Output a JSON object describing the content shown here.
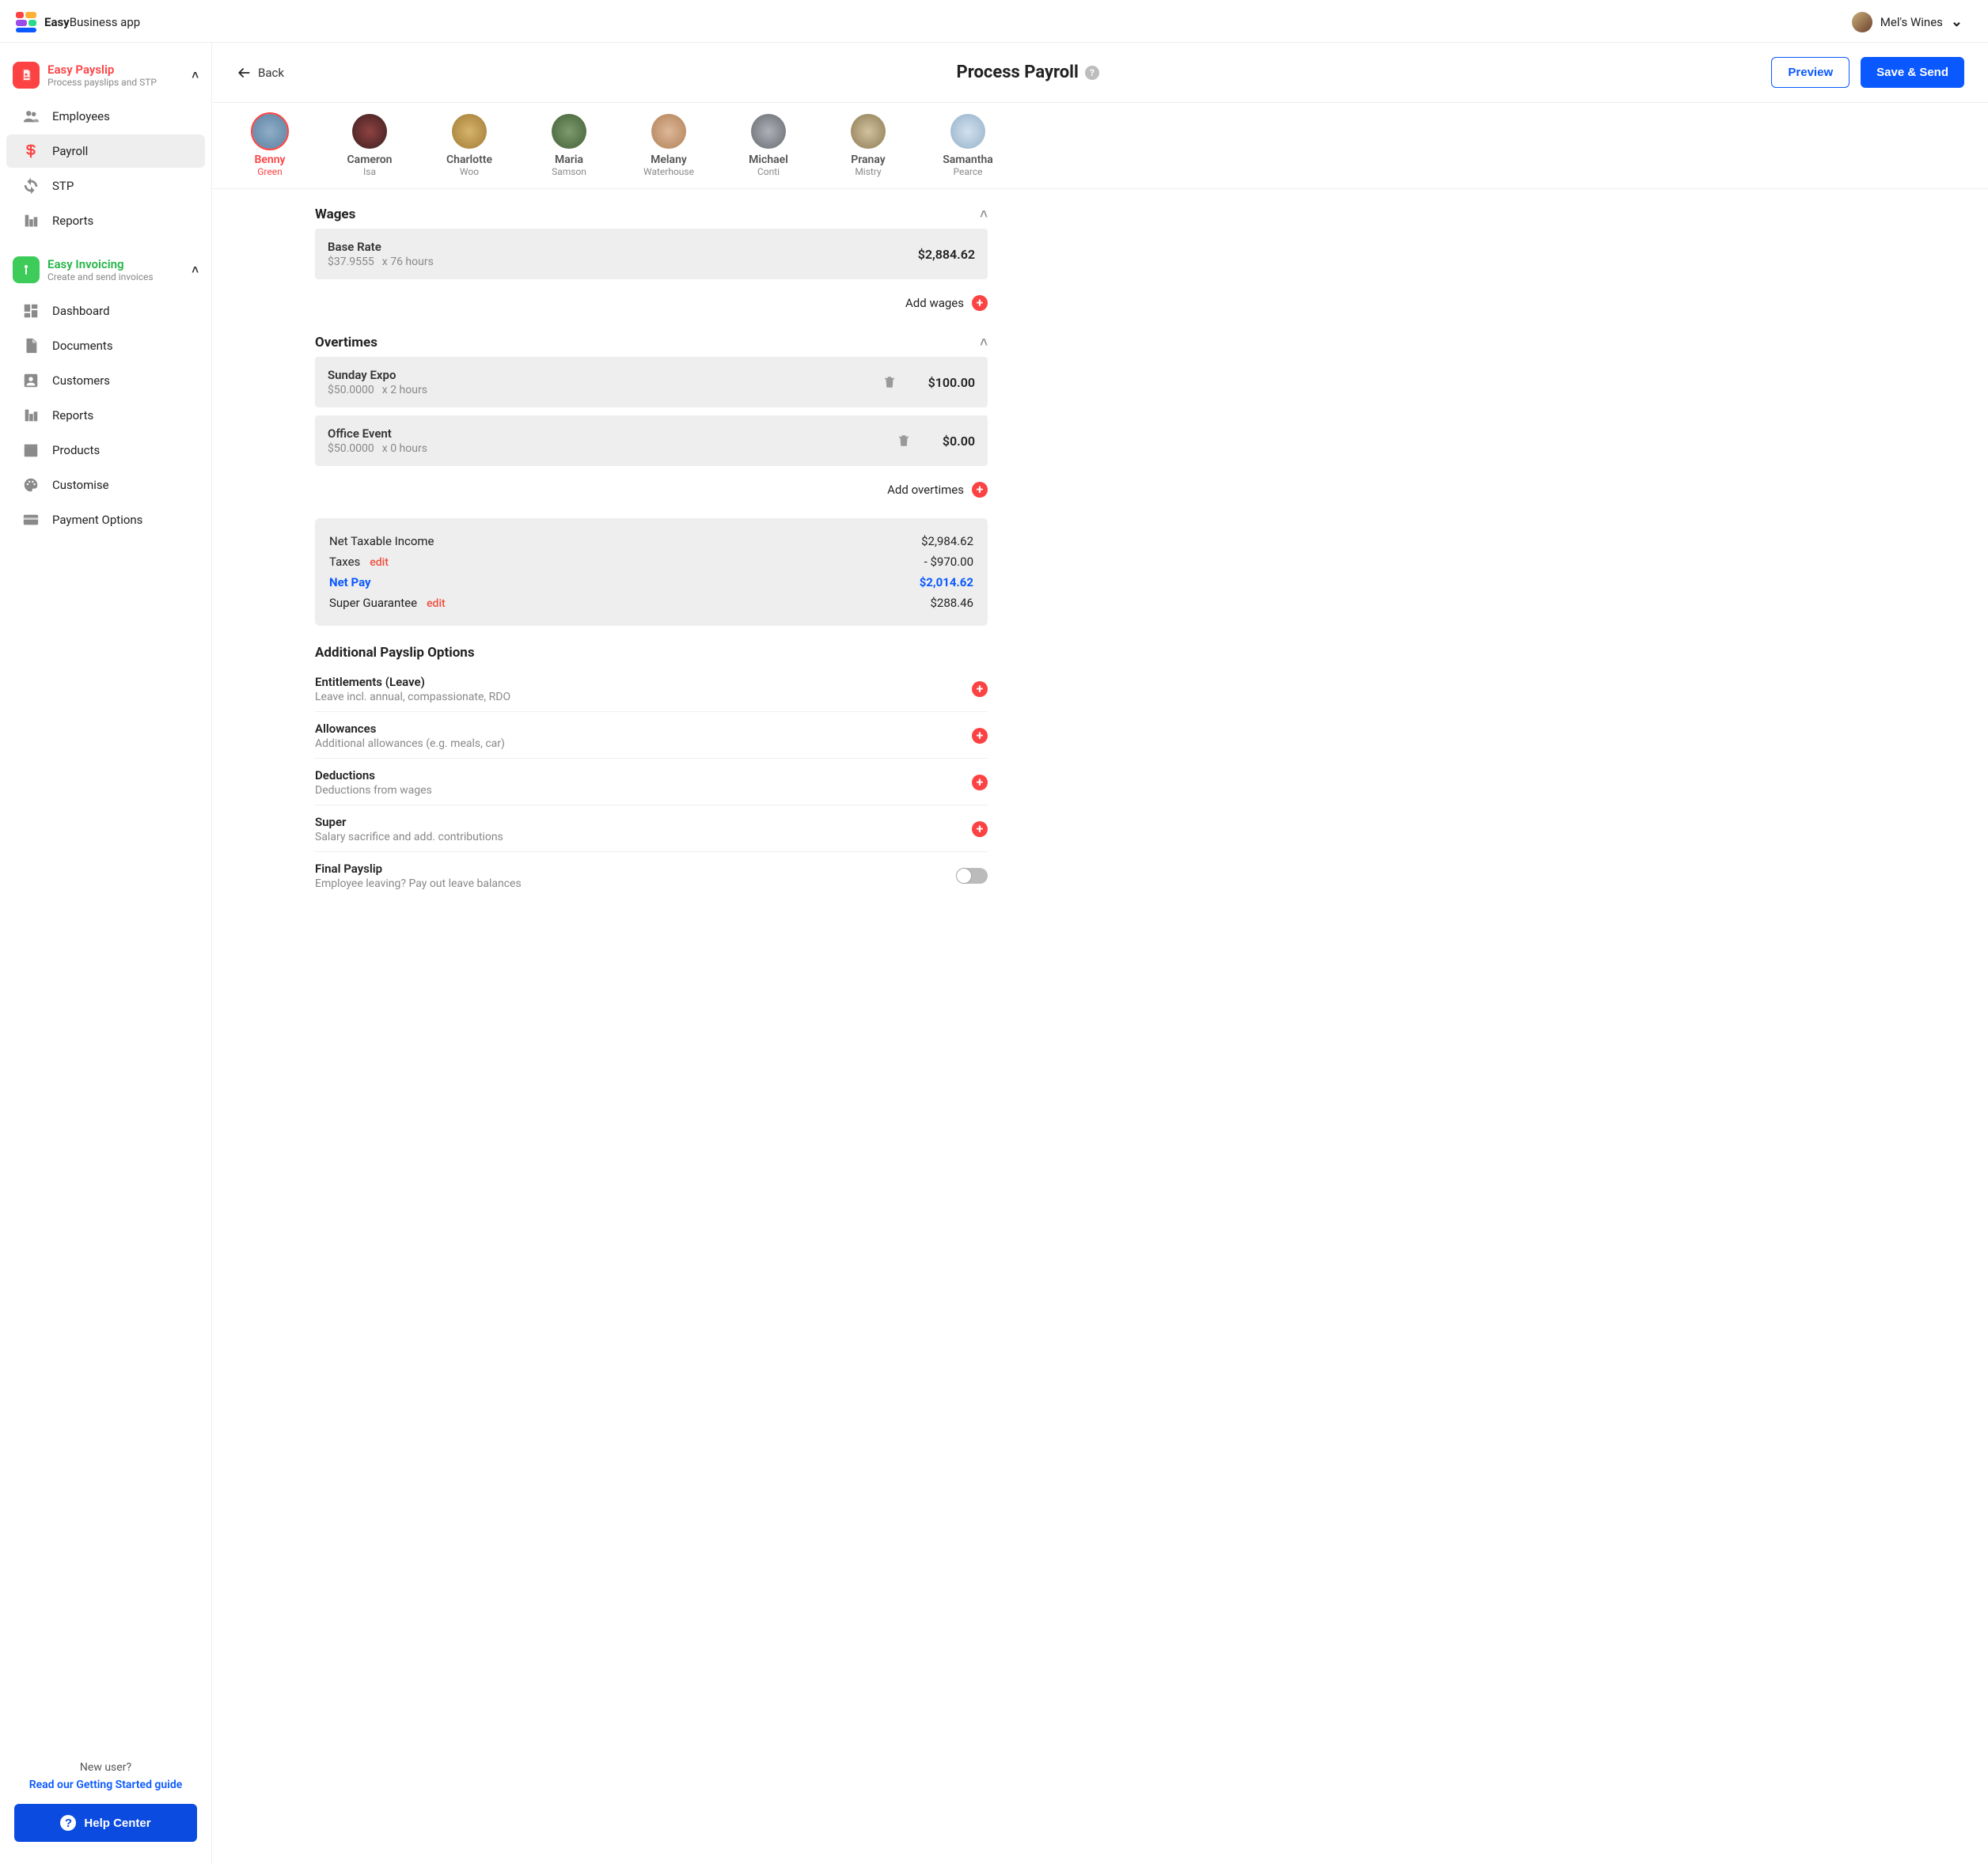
{
  "brand": {
    "bold": "Easy",
    "rest": "Business app"
  },
  "account": {
    "label": "Mel's Wines"
  },
  "modules": {
    "payslip": {
      "title": "Easy Payslip",
      "sub": "Process payslips and STP",
      "color": "#fc4242"
    },
    "invoicing": {
      "title": "Easy Invoicing",
      "sub": "Create and send invoices",
      "color": "#3dcb5a"
    }
  },
  "nav_payslip": [
    {
      "label": "Employees",
      "icon": "users"
    },
    {
      "label": "Payroll",
      "icon": "dollar",
      "active": true
    },
    {
      "label": "STP",
      "icon": "sync"
    },
    {
      "label": "Reports",
      "icon": "reports"
    }
  ],
  "nav_invoicing": [
    {
      "label": "Dashboard",
      "icon": "dashboard"
    },
    {
      "label": "Documents",
      "icon": "document"
    },
    {
      "label": "Customers",
      "icon": "customer"
    },
    {
      "label": "Reports",
      "icon": "reports"
    },
    {
      "label": "Products",
      "icon": "products"
    },
    {
      "label": "Customise",
      "icon": "palette"
    },
    {
      "label": "Payment Options",
      "icon": "card"
    }
  ],
  "sidebar_footer": {
    "new_user": "New user?",
    "guide": "Read our Getting Started guide",
    "help": "Help Center"
  },
  "header": {
    "back": "Back",
    "title": "Process Payroll",
    "preview": "Preview",
    "save": "Save & Send"
  },
  "employees": [
    {
      "first": "Benny",
      "last": "Green",
      "selected": true
    },
    {
      "first": "Cameron",
      "last": "Isa"
    },
    {
      "first": "Charlotte",
      "last": "Woo"
    },
    {
      "first": "Maria",
      "last": "Samson"
    },
    {
      "first": "Melany",
      "last": "Waterhouse"
    },
    {
      "first": "Michael",
      "last": "Conti"
    },
    {
      "first": "Pranay",
      "last": "Mistry"
    },
    {
      "first": "Samantha",
      "last": "Pearce"
    }
  ],
  "wages": {
    "title": "Wages",
    "base": {
      "name": "Base Rate",
      "rate": "$37.9555",
      "mult": "x 76 hours",
      "amount": "$2,884.62"
    },
    "add_label": "Add wages"
  },
  "overtimes": {
    "title": "Overtimes",
    "items": [
      {
        "name": "Sunday Expo",
        "rate": "$50.0000",
        "mult": "x 2 hours",
        "amount": "$100.00"
      },
      {
        "name": "Office Event",
        "rate": "$50.0000",
        "mult": "x 0 hours",
        "amount": "$0.00"
      }
    ],
    "add_label": "Add overtimes"
  },
  "summary": {
    "net_taxable": {
      "label": "Net Taxable Income",
      "value": "$2,984.62"
    },
    "taxes": {
      "label": "Taxes",
      "edit": "edit",
      "value": "- $970.00"
    },
    "net_pay": {
      "label": "Net Pay",
      "value": "$2,014.62"
    },
    "super": {
      "label": "Super Guarantee",
      "edit": "edit",
      "value": "$288.46"
    }
  },
  "additional": {
    "title": "Additional Payslip Options",
    "items": [
      {
        "title": "Entitlements (Leave)",
        "sub": "Leave incl. annual, compassionate, RDO",
        "action": "plus"
      },
      {
        "title": "Allowances",
        "sub": "Additional allowances (e.g. meals, car)",
        "action": "plus"
      },
      {
        "title": "Deductions",
        "sub": "Deductions from wages",
        "action": "plus"
      },
      {
        "title": "Super",
        "sub": "Salary sacrifice and add. contributions",
        "action": "plus"
      },
      {
        "title": "Final Payslip",
        "sub": "Employee leaving? Pay out leave balances",
        "action": "toggle"
      }
    ]
  }
}
